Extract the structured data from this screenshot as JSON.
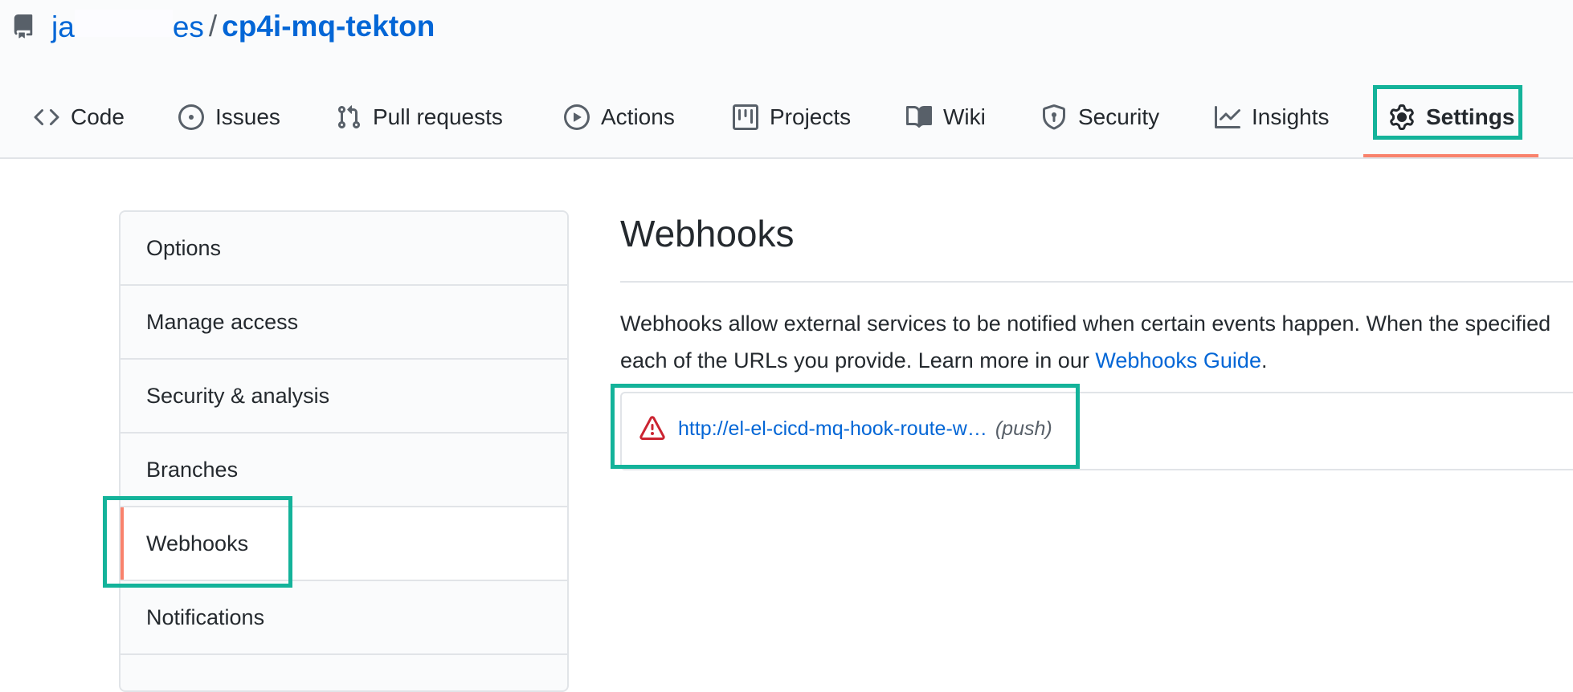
{
  "repo": {
    "owner_start": "ja",
    "owner_end": "es",
    "separator": "/",
    "name": "cp4i-mq-tekton",
    "icon": "repo-icon"
  },
  "tabs": [
    {
      "label": "Code",
      "icon": "code-icon"
    },
    {
      "label": "Issues",
      "icon": "issue-opened-icon"
    },
    {
      "label": "Pull requests",
      "icon": "git-pull-request-icon"
    },
    {
      "label": "Actions",
      "icon": "play-icon"
    },
    {
      "label": "Projects",
      "icon": "project-icon"
    },
    {
      "label": "Wiki",
      "icon": "book-icon"
    },
    {
      "label": "Security",
      "icon": "shield-icon"
    },
    {
      "label": "Insights",
      "icon": "graph-icon"
    },
    {
      "label": "Settings",
      "icon": "gear-icon",
      "selected": true
    }
  ],
  "sidebar": {
    "items": [
      {
        "label": "Options"
      },
      {
        "label": "Manage access"
      },
      {
        "label": "Security & analysis"
      },
      {
        "label": "Branches"
      },
      {
        "label": "Webhooks",
        "selected": true
      },
      {
        "label": "Notifications"
      }
    ]
  },
  "main": {
    "title": "Webhooks",
    "description_line1": "Webhooks allow external services to be notified when certain events happen. When the specified",
    "description_line2_prefix": "each of the URLs you provide. Learn more in our ",
    "guide_link": "Webhooks Guide",
    "description_line2_suffix": ".",
    "hooks": [
      {
        "url": "http://el-el-cicd-mq-hook-route-w…",
        "events": "(push)",
        "status_icon": "alert-icon"
      }
    ]
  },
  "colors": {
    "highlight": "#14b39a",
    "accent": "#f9826c",
    "link": "#0366d6",
    "alert": "#cb2431"
  }
}
